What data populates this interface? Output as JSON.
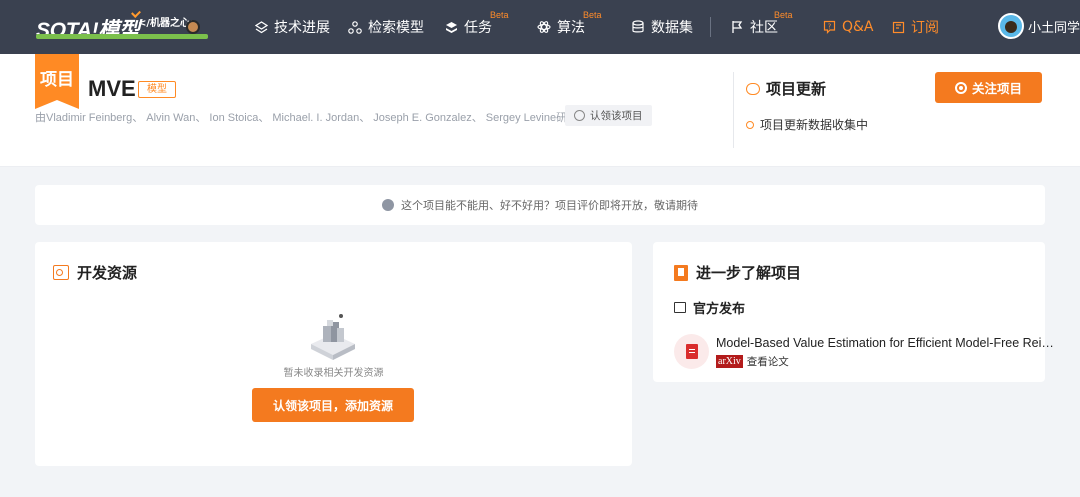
{
  "nav": {
    "logo_text": "SOTA!模型",
    "logo_sub": "</机器之心>",
    "items": [
      {
        "label": "技术进展",
        "beta": ""
      },
      {
        "label": "检索模型",
        "beta": ""
      },
      {
        "label": "任务",
        "beta": "Beta"
      },
      {
        "label": "算法",
        "beta": "Beta"
      },
      {
        "label": "数据集",
        "beta": ""
      },
      {
        "label": "社区",
        "beta": "Beta"
      },
      {
        "label": "Q&A",
        "beta": ""
      },
      {
        "label": "订阅",
        "beta": ""
      }
    ],
    "user_name": "小土同学"
  },
  "project": {
    "ribbon": "项目",
    "title": "MVE",
    "tag": "模型",
    "authors": "由Vladimir Feinberg、 Alvin Wan、 Ion Stoica、 Michael. I. Jordan、 Joseph E. Gonzalez、 Sergey Levine研发",
    "claim_label": "认领该项目",
    "update_title": "项目更新",
    "update_item": "项目更新数据收集中",
    "follow_label": "关注项目"
  },
  "notice": "这个项目能不能用、好不好用？项目评价即将开放，敬请期待",
  "dev_resources": {
    "title": "开发资源",
    "empty_text": "暂未收录相关开发资源",
    "add_label": "认领该项目，添加资源"
  },
  "learn_more": {
    "title": "进一步了解项目",
    "subtitle": "官方发布",
    "paper_title": "Model-Based Value Estimation for Efficient Model-Free Reinforcement Learning",
    "arxiv": "arXiv",
    "view_paper": "查看论文"
  },
  "colors": {
    "accent": "#f47a1f",
    "nav_bg": "#3a4150",
    "page_bg": "#f2f4f7"
  }
}
